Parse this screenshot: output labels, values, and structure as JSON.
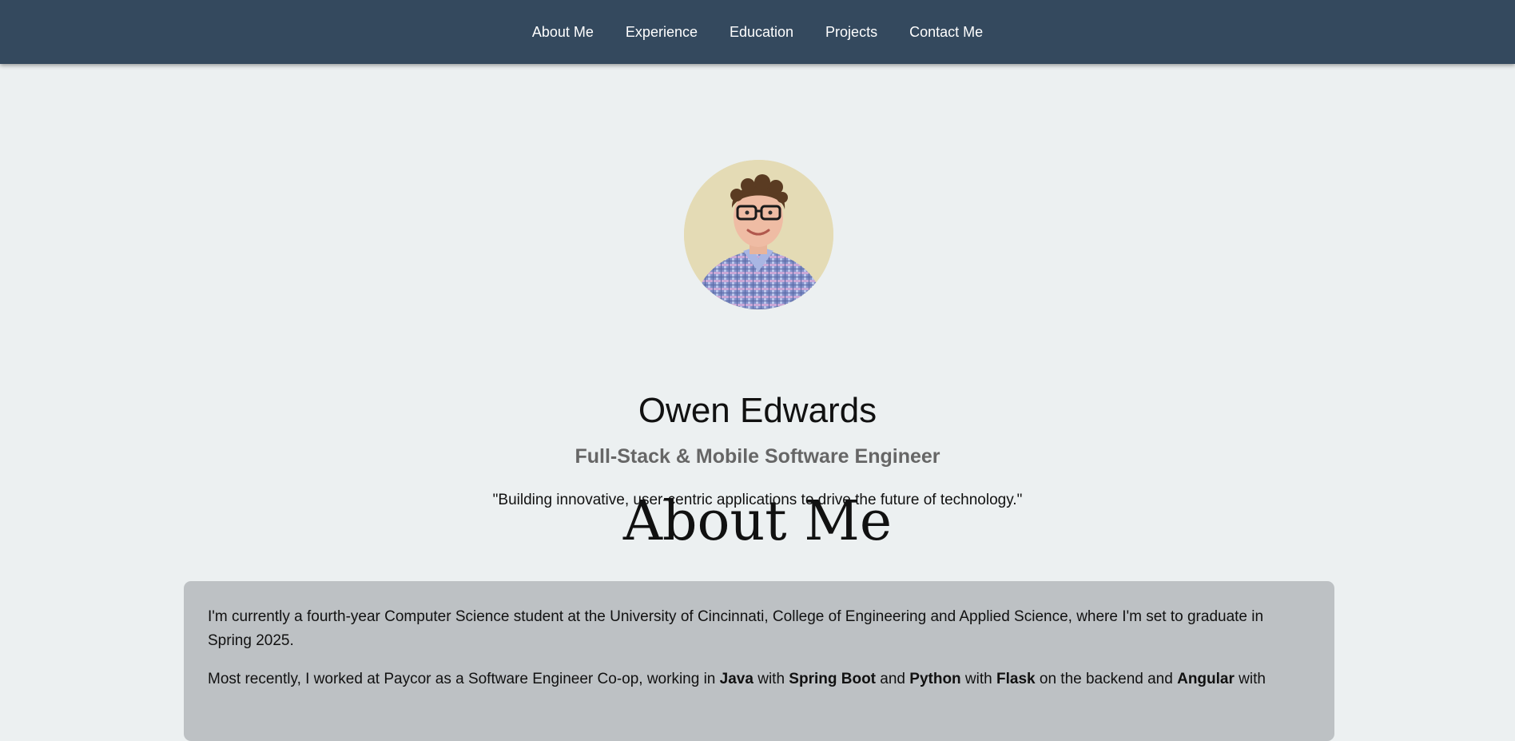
{
  "nav": {
    "items": [
      {
        "label": "About Me"
      },
      {
        "label": "Experience"
      },
      {
        "label": "Education"
      },
      {
        "label": "Projects"
      },
      {
        "label": "Contact Me"
      }
    ]
  },
  "hero": {
    "name": "Owen Edwards",
    "subtitle": "Full-Stack & Mobile Software Engineer",
    "quote": "\"Building innovative, user-centric applications to drive the future of technology.\""
  },
  "about": {
    "title": "About Me",
    "paragraph1": "I'm currently a fourth-year Computer Science student at the University of Cincinnati, College of Engineering and Applied Science, where I'm set to graduate in Spring 2025.",
    "paragraph2": {
      "t1": "Most recently, I worked at Paycor as a Software Engineer Co-op, working in ",
      "b1": "Java",
      "t2": " with ",
      "b2": "Spring Boot",
      "t3": " and ",
      "b3": "Python",
      "t4": " with ",
      "b4": "Flask",
      "t5": " on the backend and ",
      "b5": "Angular",
      "t6": " with"
    }
  },
  "colors": {
    "navbar": "#34495e",
    "page_background": "#ecf0f1",
    "card_background": "#bdc1c4"
  }
}
